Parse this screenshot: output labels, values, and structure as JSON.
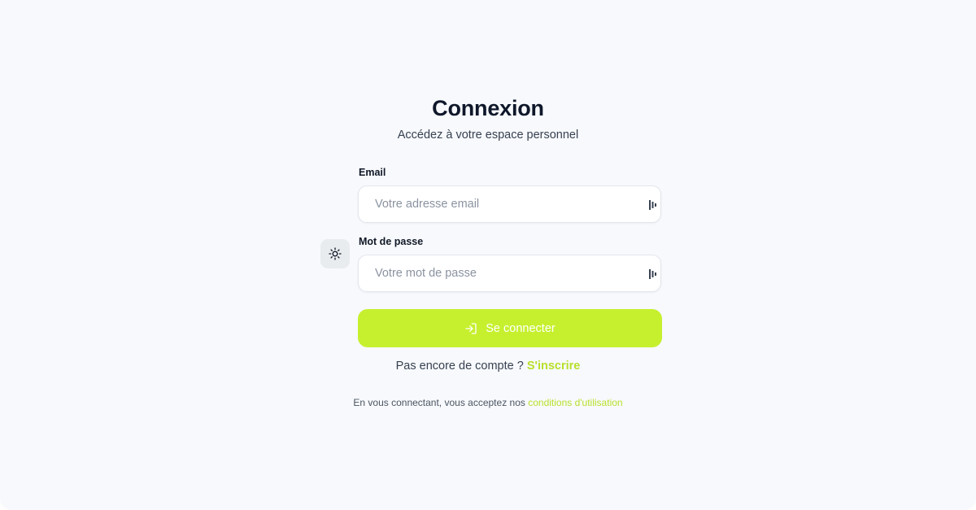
{
  "header": {
    "title": "Connexion",
    "subtitle": "Accédez à votre espace personnel"
  },
  "form": {
    "email_label": "Email",
    "email_value": "",
    "email_placeholder": "Votre adresse email",
    "password_label": "Mot de passe",
    "password_value": "",
    "password_placeholder": "Votre mot de passe",
    "password_manager_icon": "password-manager-icon",
    "submit_label": "Se connecter",
    "submit_icon": "login-arrow-icon"
  },
  "theme_toggle": {
    "icon": "sun-icon"
  },
  "signup": {
    "prompt": "Pas encore de compte ?",
    "link": "S'inscrire"
  },
  "terms": {
    "text": "En vous connectant, vous acceptez nos",
    "link": "conditions d'utilisation"
  },
  "colors": {
    "accent": "#c6f02e",
    "link": "#b8e02a",
    "background": "#f7f9fc",
    "title": "#0f172a"
  }
}
